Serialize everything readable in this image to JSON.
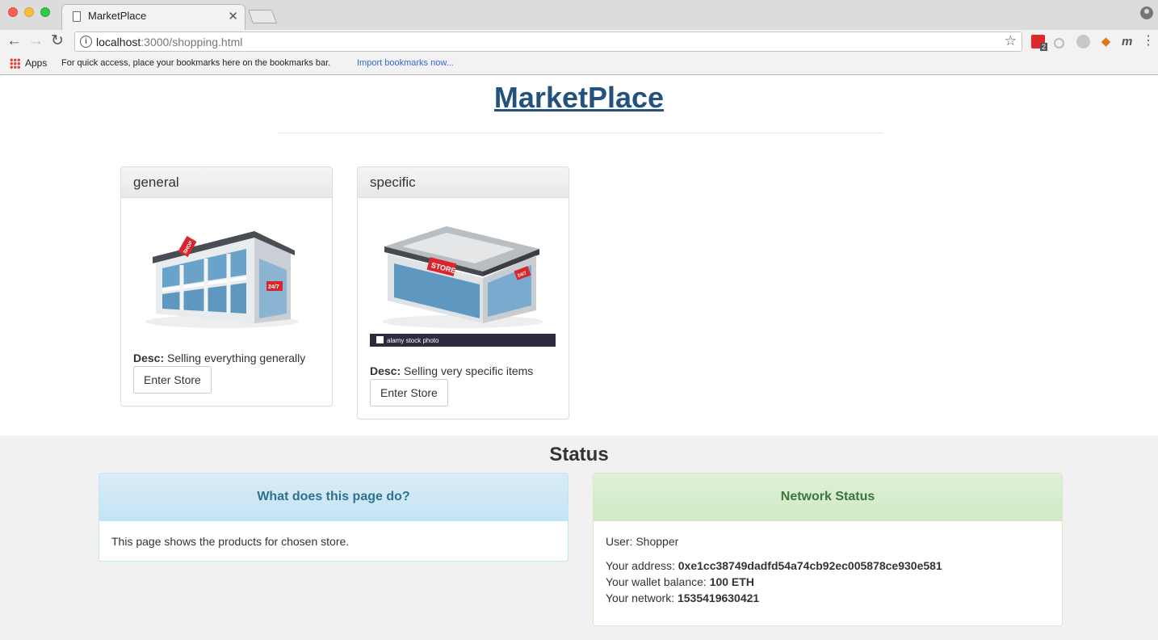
{
  "browser": {
    "tab_title": "MarketPlace",
    "url_host": "localhost",
    "url_path": ":3000/shopping.html",
    "ext_badge": "2",
    "bookmarks": {
      "apps_label": "Apps",
      "hint": "For quick access, place your bookmarks here on the bookmarks bar.",
      "import_link": "Import bookmarks now..."
    }
  },
  "page": {
    "title": "MarketPlace",
    "stores": [
      {
        "name": "general",
        "desc_label": "Desc:",
        "desc": "Selling everything generally",
        "button": "Enter Store",
        "image_sign": "SHOP",
        "image_side": "24/7"
      },
      {
        "name": "specific",
        "desc_label": "Desc:",
        "desc": "Selling very specific items",
        "button": "Enter Store",
        "image_sign": "STORE",
        "image_side": "24/7",
        "image_caption": "alamy stock photo"
      }
    ],
    "status": {
      "title": "Status",
      "info_panel": {
        "heading": "What does this page do?",
        "body": "This page shows the products for chosen store."
      },
      "network_panel": {
        "heading": "Network Status",
        "user_label": "User:",
        "user": "Shopper",
        "address_label": "Your address:",
        "address": "0xe1cc38749dadfd54a74cb92ec005878ce930e581",
        "balance_label": "Your wallet balance:",
        "balance": "100 ETH",
        "network_label": "Your network:",
        "network": "1535419630421"
      }
    }
  },
  "colors": {
    "title_link": "#23527c",
    "info_heading": "#31708f",
    "success_heading": "#3c763d",
    "status_bg": "#f1f1f1"
  }
}
